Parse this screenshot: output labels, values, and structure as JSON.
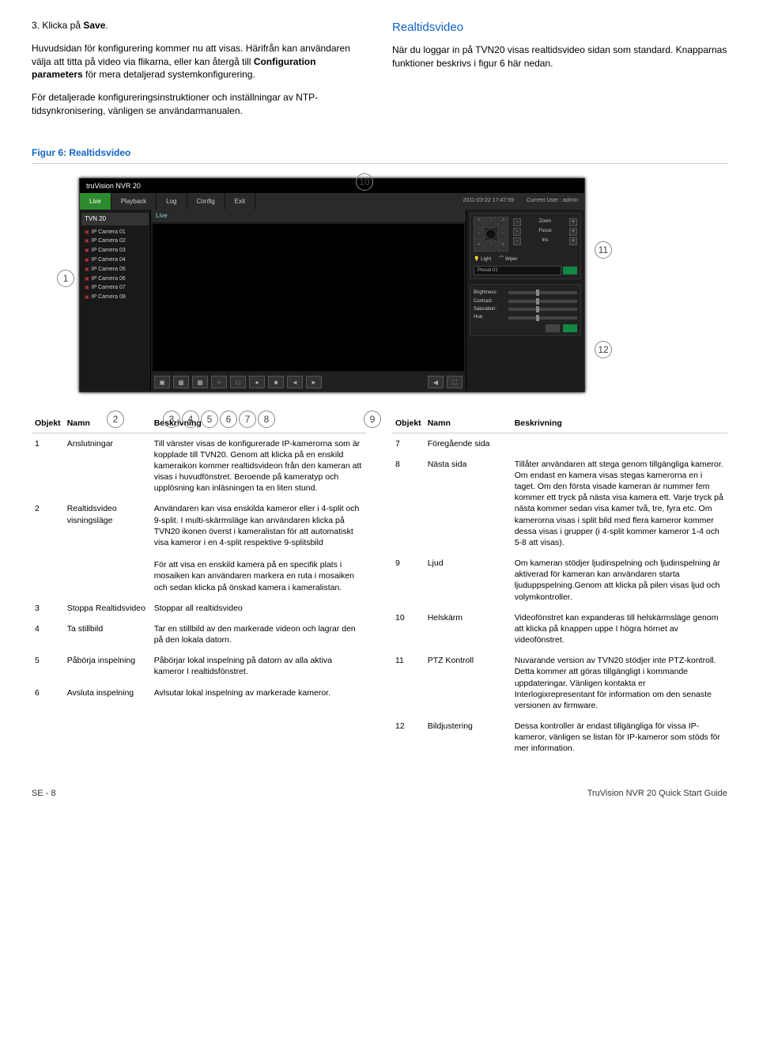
{
  "left_col": {
    "step3": "3.   Klicka på ",
    "step3_bold": "Save",
    "step3_end": ".",
    "p1": "Huvudsidan för konfigurering kommer nu att visas. Härifrån kan användaren välja att titta på video via flikarna, eller kan återgå till ",
    "p1_bold": "Configuration parameters",
    "p1_end": " för mera detaljerad systemkonfigurering.",
    "p2": "För detaljerade konfigureringsinstruktioner och inställningar av NTP-tidsynkronisering, vänligen se användarmanualen."
  },
  "right_col": {
    "h": "Realtidsvideo",
    "p1": "När du loggar in på TVN20 visas realtidsvideo sidan som standard. Knapparnas funktioner beskrivs i figur 6 här nedan."
  },
  "figure_title": "Figur 6: Realtidsvideo",
  "callouts": [
    "1",
    "2",
    "3",
    "4",
    "5",
    "6",
    "7",
    "8",
    "9",
    "10",
    "11",
    "12"
  ],
  "app": {
    "title": "truVision NVR 20",
    "menu": [
      "Live",
      "Playback",
      "Log",
      "Config",
      "Exit"
    ],
    "date": "2011-03-22  17:47:59",
    "user": "Current User : admin",
    "sidebar_top": "TVN 20",
    "sidebar": [
      "IP Camera 01",
      "IP Camera 02",
      "IP Camera 03",
      "IP Camera 04",
      "IP Camera 05",
      "IP Camera 06",
      "IP Camera 07",
      "IP Camera 08"
    ],
    "tab": "Live",
    "toolbar": [
      "▣",
      "▦",
      "▦",
      "○",
      "□",
      "●",
      "■",
      "◀",
      "◄",
      "►",
      "⛶"
    ],
    "ptz_labels": {
      "zoom": "Zoom",
      "focus": "Focus",
      "iris": "Iris",
      "light": "Light",
      "wiper": "Wiper",
      "preset": "Preset 01"
    },
    "adj": {
      "brightness": "Brightness:",
      "contrast": "Contrast:",
      "saturation": "Saturation:",
      "hue": "Hue:"
    }
  },
  "table_left": {
    "head": [
      "Objekt",
      "Namn",
      "Beskrivning"
    ],
    "rows": [
      {
        "obj": "1",
        "name": "Anslutningar",
        "desc": "Till vänster visas de konfigurerade IP-kamerorna som är kopplade till TVN20. Genom att klicka på en enskild kameraikon kommer realtidsvideon från den kameran att visas i huvudfönstret. Beroende på kameratyp och upplösning kan inläsningen ta en liten stund."
      },
      {
        "obj": "2",
        "name": "Realtidsvideo visningsläge",
        "desc": "Användaren kan visa enskilda kameror eller i 4-split och 9-split. I multi-skärmsläge kan användaren klicka på TVN20 ikonen överst i kameralistan för att automatiskt visa kameror i en 4-split respektive 9-splitsbild\n\nFör att visa en enskild kamera på en specifik plats i mosaiken kan användaren markera en ruta i mosaiken och sedan klicka på önskad kamera i kameralistan."
      },
      {
        "obj": "3",
        "name": "Stoppa Realtidsvideo",
        "desc": "Stoppar all realtidsvideo"
      },
      {
        "obj": "4",
        "name": "Ta stillbild",
        "desc": "Tar en stillbild av den markerade videon och lagrar den på den lokala datorn."
      },
      {
        "obj": "5",
        "name": "Påbörja inspelning",
        "desc": "Påbörjar lokal inspelning på datorn av alla aktiva kameror I realtidsfönstret."
      },
      {
        "obj": "6",
        "name": "Avsluta inspelning",
        "desc": "Avlsutar lokal inspelning av markerade kameror."
      }
    ]
  },
  "table_right": {
    "head": [
      "Objekt",
      "Namn",
      "Beskrivning"
    ],
    "rows": [
      {
        "obj": "7",
        "name": "Föregående sida",
        "desc": ""
      },
      {
        "obj": "8",
        "name": "Nästa sida",
        "desc": "Tillåter användaren att stega genom tillgängliga kameror. Om endast en kamera visas stegas kamerorna en i taget. Om den första visade kameran är nummer fem kommer ett tryck på nästa visa kamera ett. Varje tryck på nästa kommer sedan visa kamer två, tre, fyra etc. Om kamerorna visas i split bild med flera kameror kommer dessa visas i grupper (i 4-split kommer kameror 1-4 och 5-8 att visas)."
      },
      {
        "obj": "9",
        "name": "Ljud",
        "desc": "Om kameran stödjer ljudinspelning och ljudinspelning är aktiverad för kameran kan användaren starta ljuduppspelning.Genom att klicka på pilen visas ljud och volymkontroller."
      },
      {
        "obj": "10",
        "name": "Helskärm",
        "desc": "Videofönstret kan expanderas till helskärmsläge genom att klicka på knappen uppe I högra hörnet av videofönstret."
      },
      {
        "obj": "11",
        "name": "PTZ Kontroll",
        "desc": "Nuvarande version av TVN20 stödjer inte PTZ-kontroll. Detta kommer att göras tillgängligt i kommande uppdateringar. Vänligen kontakta er Interlogixrepresentant för information om den senaste versionen av firmware."
      },
      {
        "obj": "12",
        "name": "Bildjustering",
        "desc": "Dessa kontroller är endast tillgängliga för vissa IP-kameror, vänligen se listan för IP-kameror som stöds för mer information."
      }
    ]
  },
  "footer": {
    "left": "SE  -  8",
    "right": "TruVision NVR 20 Quick Start Guide"
  }
}
